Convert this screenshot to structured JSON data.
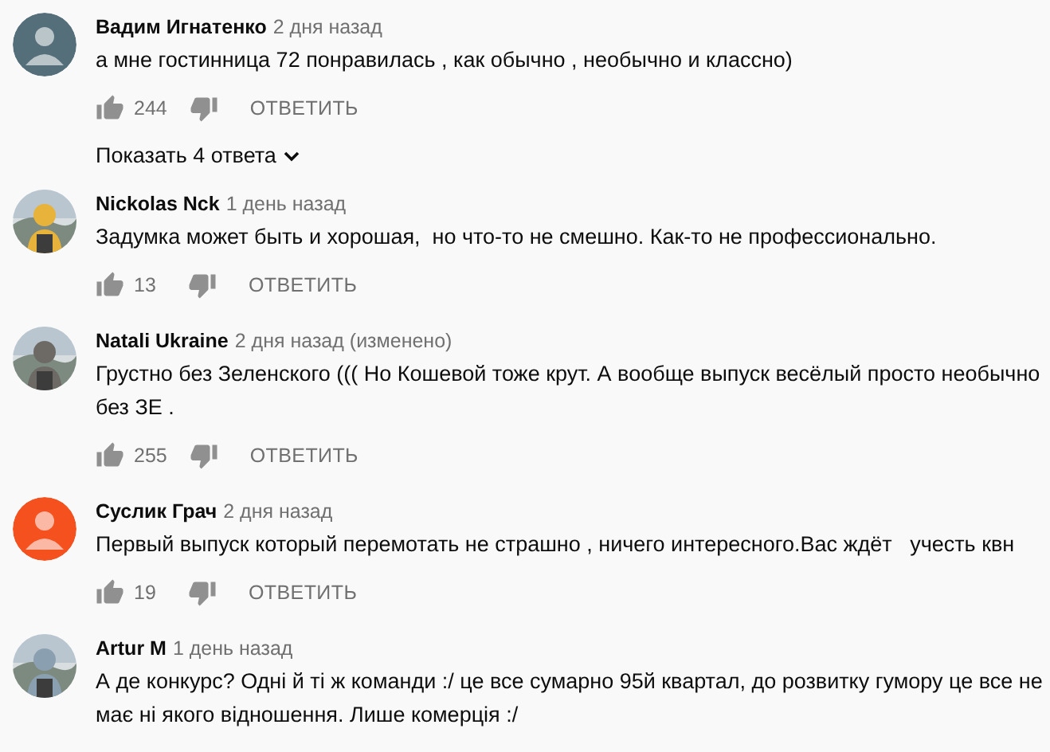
{
  "comments": [
    {
      "author": "Вадим Игнатенко",
      "time": "2 дня назад",
      "avatar": {
        "kind": "default",
        "color": "#546e7a"
      },
      "text": "а мне гостинница 72 понравилась , как обычно , необычно и классно)",
      "likes": "244",
      "reply": "ОТВЕТИТЬ",
      "show_replies": "Показать 4 ответа"
    },
    {
      "author": "Nickolas Nck",
      "time": "1 день назад",
      "text": "Задумка может быть и хорошая,  но что-то не смешно. Как-то не профессионально.",
      "likes": "13",
      "reply": "ОТВЕТИТЬ"
    },
    {
      "author": "Natali Ukraine",
      "time": "2 дня назад (изменено)",
      "text": "Грустно без Зеленского ((( Но Кошевой тоже крут. А вообще выпуск весёлый просто необычно без ЗЕ .",
      "likes": "255",
      "reply": "ОТВЕТИТЬ"
    },
    {
      "author": "Суслик Грач",
      "time": "2 дня назад",
      "avatar": {
        "kind": "default",
        "color": "#f4511e"
      },
      "text": "Первый выпуск который перемотать не страшно , ничего интересного.Вас ждёт   учесть квн",
      "likes": "19",
      "reply": "ОТВЕТИТЬ"
    },
    {
      "author": "Artur M",
      "time": "1 день назад",
      "text": "А де конкурс? Одні й ті ж команди :/ це все сумарно 95й квартал, до розвитку гумору це все не має ні якого відношення. Лише комерція :/"
    }
  ]
}
